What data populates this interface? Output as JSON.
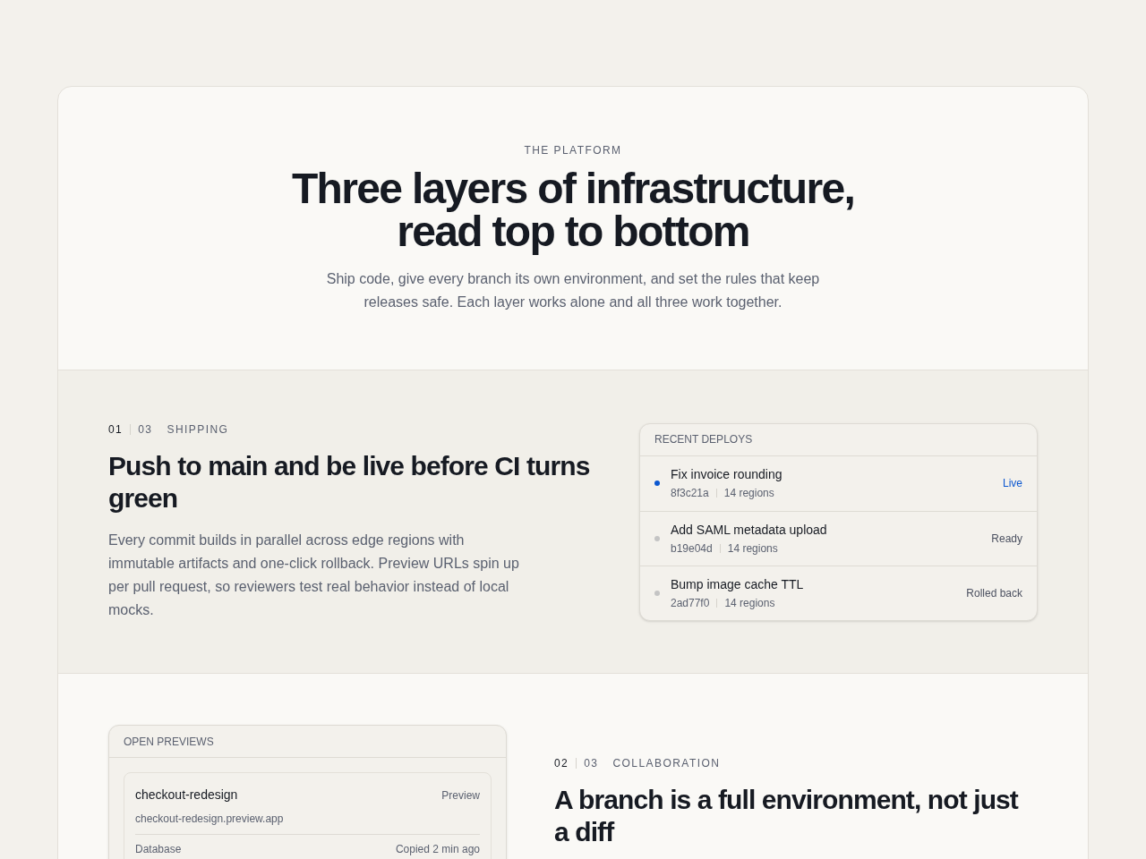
{
  "header": {
    "eyebrow": "THE PLATFORM",
    "title": "Three layers of infrastructure, read top to bottom",
    "intro": "Ship code, give every branch its own environment, and set the rules that keep releases safe. Each layer works alone and all three work together."
  },
  "sections": [
    {
      "index": "01",
      "total": "03",
      "label": "SHIPPING",
      "title": "Push to main and be live before CI turns green",
      "body": "Every commit builds in parallel across edge regions with immutable artifacts and one-click rollback. Preview URLs spin up per pull request, so reviewers test real behavior instead of local mocks.",
      "panel": {
        "kind": "deploys",
        "title": "RECENT DEPLOYS",
        "rows": [
          {
            "name": "Fix invoice rounding",
            "commit": "8f3c21a",
            "regions": "14 regions",
            "status": "Live",
            "live": true,
            "color": "#0b57d0"
          },
          {
            "name": "Add SAML metadata upload",
            "commit": "b19e04d",
            "regions": "14 regions",
            "status": "Ready",
            "live": false,
            "color": "#c4c4c4"
          },
          {
            "name": "Bump image cache TTL",
            "commit": "2ad77f0",
            "regions": "14 regions",
            "status": "Rolled back",
            "live": false,
            "color": "#c4c4c4"
          }
        ]
      }
    },
    {
      "index": "02",
      "total": "03",
      "label": "COLLABORATION",
      "title": "A branch is a full environment, not just a diff",
      "panel": {
        "kind": "previews",
        "title": "OPEN PREVIEWS",
        "items": [
          {
            "branch": "checkout-redesign",
            "badge": "Preview",
            "url": "checkout-redesign.preview.app",
            "detail_label": "Database",
            "detail_value": "Copied 2 min ago"
          }
        ]
      }
    }
  ]
}
